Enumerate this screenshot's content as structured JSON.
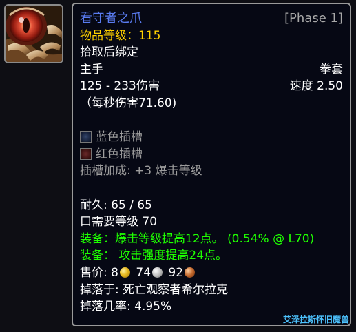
{
  "item": {
    "icon_name": "claw-weapon-icon",
    "name": "看守者之爪",
    "phase": "[Phase 1]",
    "item_level_label": "物品等级：",
    "item_level_value": "115",
    "binding": "拾取后绑定",
    "slot": "主手",
    "weapon_type": "拳套",
    "damage": "125 - 233伤害",
    "speed_label": "速度 2.50",
    "dps": "（每秒伤害71.60)",
    "sockets": [
      {
        "color": "blue",
        "label": "蓝色插槽"
      },
      {
        "color": "red",
        "label": "红色插槽"
      }
    ],
    "socket_bonus": "插槽加成: +3 爆击等级",
    "durability": "耐久: 65 / 65",
    "required_level": "口需要等级 70",
    "equip_effects": [
      "装备：爆击等级提高12点。 (0.54% @ L70)",
      "装备：  攻击强度提高24点。"
    ],
    "sell_price": {
      "label": "售价:",
      "gold": "8",
      "silver": "74",
      "copper": "92"
    },
    "drop_source": "掉落于: 死亡观察者希尔拉克",
    "drop_rate": "掉落几率: 4.95%"
  },
  "watermark": "艾泽拉斯怀旧魔兽",
  "colors": {
    "name": "#5a7cf0",
    "item_level_label": "#ffd100",
    "grey_text": "#9d9d9d",
    "equip_green": "#1eff00",
    "watermark": "#4dc3ff"
  }
}
